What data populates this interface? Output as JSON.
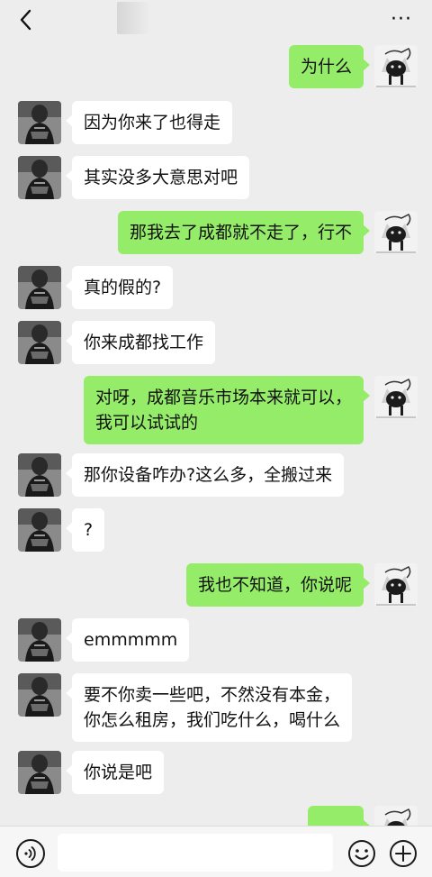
{
  "header": {
    "back_icon": "chevron-left-icon",
    "contact_name": ")",
    "more_label": "···"
  },
  "messages": [
    {
      "side": "right",
      "text": "为什么"
    },
    {
      "side": "left",
      "text": "因为你来了也得走"
    },
    {
      "side": "left",
      "text": "其实没多大意思对吧"
    },
    {
      "side": "right",
      "text": "那我去了成都就不走了，行不"
    },
    {
      "side": "left",
      "text": "真的假的?"
    },
    {
      "side": "left",
      "text": "你来成都找工作"
    },
    {
      "side": "right",
      "text": "对呀，成都音乐市场本来就可以，\n我可以试试的"
    },
    {
      "side": "left",
      "text": "那你设备咋办?这么多，全搬过来"
    },
    {
      "side": "left",
      "text": "?"
    },
    {
      "side": "right",
      "text": "我也不知道，你说呢"
    },
    {
      "side": "left",
      "text": "emmmmm"
    },
    {
      "side": "left",
      "text": "要不你卖一些吧，不然没有本金，\n你怎么租房，我们吃什么，喝什么"
    },
    {
      "side": "left",
      "text": "你说是吧"
    },
    {
      "side": "right",
      "text": "......"
    }
  ],
  "input": {
    "value": "",
    "placeholder": ""
  },
  "icons": {
    "voice": "voice-icon",
    "emoji": "emoji-icon",
    "plus": "plus-icon"
  },
  "colors": {
    "background": "#ededed",
    "bubble_self": "#95ec69",
    "bubble_other": "#ffffff"
  }
}
